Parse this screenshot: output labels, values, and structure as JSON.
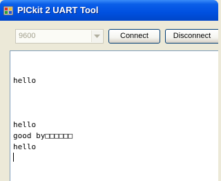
{
  "window": {
    "title": "PICkit 2 UART Tool"
  },
  "toolbar": {
    "baud_value": "9600",
    "connect_label": "Connect",
    "disconnect_label": "Disconnect"
  },
  "terminal": {
    "lines": [
      "hello",
      "hello",
      "good by□□□□□□",
      "hello"
    ]
  }
}
